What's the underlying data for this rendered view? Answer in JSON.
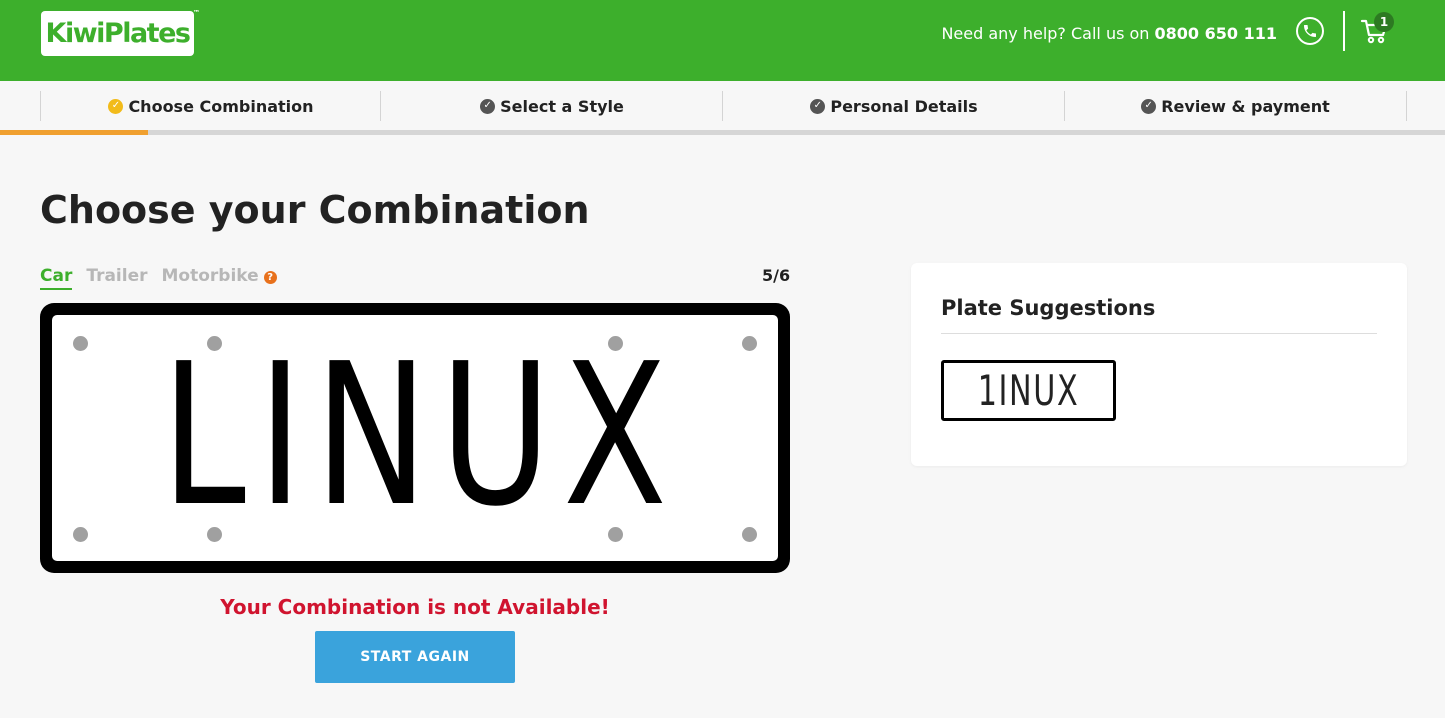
{
  "header": {
    "logo_text": "KiwiPlates",
    "logo_tm": "™",
    "help_prefix": "Need any help? Call us on ",
    "help_phone": "0800 650 111",
    "cart_count": "1",
    "brand_color": "#3daf2c"
  },
  "steps": [
    {
      "label": "Choose Combination",
      "state": "active"
    },
    {
      "label": "Select a Style",
      "state": "todo"
    },
    {
      "label": "Personal Details",
      "state": "todo"
    },
    {
      "label": "Review & payment",
      "state": "todo"
    }
  ],
  "main": {
    "title": "Choose your Combination",
    "vehicle_tabs": [
      {
        "label": "Car",
        "active": true
      },
      {
        "label": "Trailer",
        "active": false
      },
      {
        "label": "Motorbike",
        "active": false
      }
    ],
    "help_glyph": "?",
    "counter": "5/6",
    "plate_text": "LINUX",
    "status_message": "Your Combination is not Available!",
    "status_color": "#d0142f",
    "start_again_label": "START AGAIN"
  },
  "suggestions": {
    "title": "Plate Suggestions",
    "items": [
      "1INUX"
    ]
  },
  "icons": {
    "phone": "phone-icon",
    "cart": "cart-icon",
    "check": "check-circle-icon",
    "help": "help-circle-icon"
  }
}
